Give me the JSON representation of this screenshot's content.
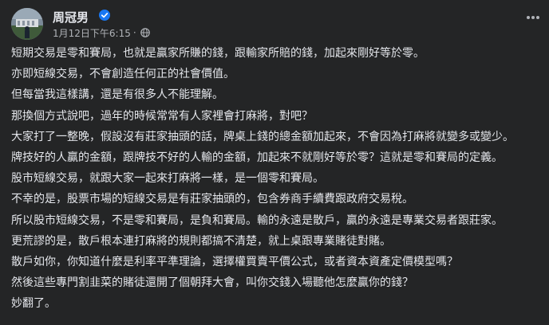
{
  "post": {
    "author": "周冠男",
    "timestamp": "1月12日下午6:15",
    "separator": "·",
    "audience_icon": "globe-icon",
    "more_icon": "more-options-icon",
    "paragraphs": [
      "短期交易是零和賽局，也就是贏家所賺的錢，跟輸家所賠的錢，加起來剛好等於零。",
      "亦即短線交易，不會創造任何正的社會價值。",
      "但每當我這樣講，還是有很多人不能理解。",
      "那換個方式說吧，過年的時候常常有人家裡會打麻將，對吧？",
      "大家打了一整晚，假設沒有莊家抽頭的話，牌桌上錢的總金額加起來，不會因為打麻將就變多或變少。",
      "牌技好的人贏的金額，跟牌技不好的人輸的金額，加起來不就剛好等於零？這就是零和賽局的定義。",
      "股市短線交易，就跟大家一起來打麻將一樣，是一個零和賽局。",
      "不幸的是，股票市場的短線交易是有莊家抽頭的，包含券商手續費跟政府交易稅。",
      "所以股市短線交易，不是零和賽局，是負和賽局。輸的永遠是散戶，贏的永遠是專業交易者跟莊家。",
      "更荒謬的是，散戶根本連打麻將的規則都搞不清楚，就上桌跟專業賭徒對賭。",
      "散戶如你，你知道什麼是利率平準理論，選擇權買賣平價公式，或者資本資產定價模型嗎？",
      "然後這些專門割韭菜的賭徒還開了個朝拜大會，叫你交錢入場聽他怎麼贏你的錢？",
      "妙翻了。"
    ]
  },
  "colors": {
    "background": "#242526",
    "text": "#e4e6eb",
    "secondary_text": "#b0b3b8",
    "verified_badge": "#1877f2"
  }
}
